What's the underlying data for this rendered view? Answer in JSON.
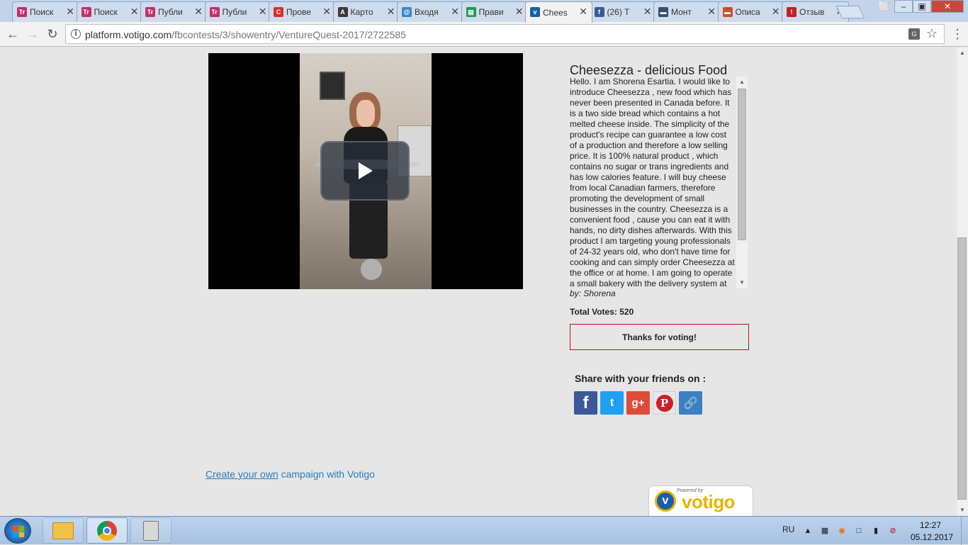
{
  "browser": {
    "tabs": [
      {
        "title": "Поиск",
        "favicon": "tr-icon",
        "favicon_color": "#c0306a",
        "active": false
      },
      {
        "title": "Поиск",
        "favicon": "tr-icon",
        "favicon_color": "#c0306a",
        "active": false
      },
      {
        "title": "Публи",
        "favicon": "tr-icon",
        "favicon_color": "#c0306a",
        "active": false
      },
      {
        "title": "Публи",
        "favicon": "tr-icon",
        "favicon_color": "#c0306a",
        "active": false
      },
      {
        "title": "Прове",
        "favicon": "copyright-icon",
        "favicon_color": "#d9302c",
        "active": false
      },
      {
        "title": "Карто",
        "favicon": "a-icon",
        "favicon_color": "#3a3a3a",
        "active": false
      },
      {
        "title": "Входя",
        "favicon": "mail-icon",
        "favicon_color": "#3a87c8",
        "active": false
      },
      {
        "title": "Прави",
        "favicon": "sheets-icon",
        "favicon_color": "#1e9a4f",
        "active": false
      },
      {
        "title": "Chees",
        "favicon": "votigo-icon",
        "favicon_color": "#1a5ea8",
        "active": true
      },
      {
        "title": "(26) T",
        "favicon": "facebook-icon",
        "favicon_color": "#3b5998",
        "active": false
      },
      {
        "title": "Монт",
        "favicon": "car-icon",
        "favicon_color": "#33506f",
        "active": false
      },
      {
        "title": "Описа",
        "favicon": "car-red-icon",
        "favicon_color": "#c8502c",
        "active": false
      },
      {
        "title": "Отзыв",
        "favicon": "otzyv-icon",
        "favicon_color": "#c0202a",
        "active": false
      }
    ],
    "url_host": "platform.votigo.com",
    "url_path": "/fbcontests/3/showentry/VentureQuest-2017/2722585",
    "user_badge": "⬜",
    "translate_label": "G"
  },
  "entry": {
    "title": "Cheesezza - delicious Food",
    "description": "Hello. I am Shorena Esartia. I would like to introduce Cheesezza , new food which has never been presented in Canada before. It is a two side bread which contains a hot melted  cheese inside. The simplicity of the product's recipe can guarantee a low cost of a production and therefore a low selling price. It is 100% natural product , which contains no sugar or trans ingredients and has low calories feature. I will buy cheese from local Canadian farmers, therefore promoting the development of small businesses in the country. Cheesezza is a convenient food , cause you can eat it with hands, no dirty dishes afterwards. With this product I am targeting young professionals of 24-32 years old, who don't have time for cooking and can simply order Cheesezza at the office or at home. I am going to operate a small bakery with the delivery system at",
    "byline": "by: Shorena",
    "votes_label": "Total Votes:",
    "votes_count": "520",
    "thanks": "Thanks for voting!"
  },
  "share": {
    "title": "Share with your friends on :",
    "facebook": "f",
    "twitter": "t",
    "googleplus": "g+",
    "pinterest": "P",
    "link": "🔗"
  },
  "footer": {
    "create_link": "Create your own",
    "create_rest": " campaign with Votigo",
    "powered_by": "Powered by",
    "brand": "votigo",
    "brand_letter": "v"
  },
  "taskbar": {
    "lang": "RU",
    "time": "12:27",
    "date": "05.12.2017"
  },
  "colors": {
    "accent_link": "#2a7ab8",
    "thanks_border": "#c01010",
    "votigo_yellow": "#e8b400",
    "votigo_blue": "#1a5ea8"
  }
}
